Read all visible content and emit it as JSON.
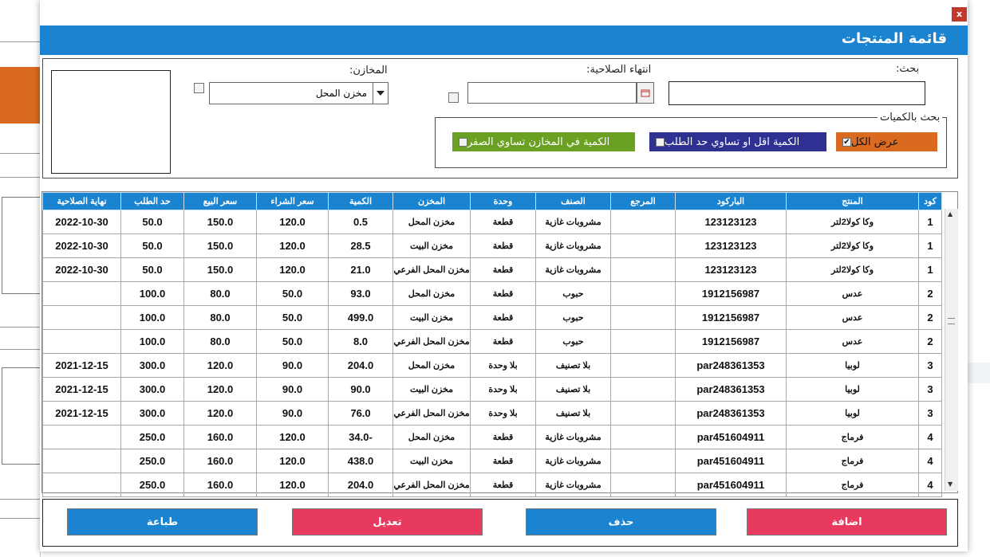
{
  "dialog": {
    "title": "قائمة المنتجات",
    "close_label": "x"
  },
  "search": {
    "label": "بحث:",
    "value": ""
  },
  "expiry": {
    "label": "انتهاء الصلاحية:",
    "value": ""
  },
  "stores": {
    "label": "المخازن:",
    "selected": "مخزن المحل"
  },
  "quantity_filter": {
    "legend": "بحث بالكميات",
    "show_all": {
      "label": "عرض الكل",
      "checked": "✔",
      "color": "#d96a1f"
    },
    "below_limit": {
      "label": "الكمية  اقل او تساوي حد  الطلب",
      "color": "#2f3192"
    },
    "zero_qty": {
      "label": "الكمية في المخازن تساوي الصفر",
      "color": "#6aa122"
    }
  },
  "grid": {
    "header_color": "#1a84d0",
    "columns": [
      "كود",
      "المنتج",
      "الباركود",
      "المرجع",
      "الصنف",
      "وحدة",
      "المخزن",
      "الكمية",
      "سعر الشراء",
      "سعر البيع",
      "حد الطلب",
      "نهاية الصلاحية"
    ],
    "rows": [
      [
        "1",
        "وكا كولا2لتر",
        "123123123",
        "",
        "مشروبات غازية",
        "قطعة",
        "مخزن المحل",
        "0.5",
        "120.0",
        "150.0",
        "50.0",
        "2022-10-30"
      ],
      [
        "1",
        "وكا كولا2لتر",
        "123123123",
        "",
        "مشروبات غازية",
        "قطعة",
        "مخزن البيت",
        "28.5",
        "120.0",
        "150.0",
        "50.0",
        "2022-10-30"
      ],
      [
        "1",
        "وكا كولا2لتر",
        "123123123",
        "",
        "مشروبات غازية",
        "قطعة",
        "مخزن المحل الفرعي",
        "21.0",
        "120.0",
        "150.0",
        "50.0",
        "2022-10-30"
      ],
      [
        "2",
        "عدس",
        "1912156987",
        "",
        "حبوب",
        "قطعة",
        "مخزن المحل",
        "93.0",
        "50.0",
        "80.0",
        "100.0",
        ""
      ],
      [
        "2",
        "عدس",
        "1912156987",
        "",
        "حبوب",
        "قطعة",
        "مخزن البيت",
        "499.0",
        "50.0",
        "80.0",
        "100.0",
        ""
      ],
      [
        "2",
        "عدس",
        "1912156987",
        "",
        "حبوب",
        "قطعة",
        "مخزن المحل الفرعي",
        "8.0",
        "50.0",
        "80.0",
        "100.0",
        ""
      ],
      [
        "3",
        "لوبيا",
        "par248361353",
        "",
        "بلا تصنيف",
        "بلا وحدة",
        "مخزن المحل",
        "204.0",
        "90.0",
        "120.0",
        "300.0",
        "2021-12-15"
      ],
      [
        "3",
        "لوبيا",
        "par248361353",
        "",
        "بلا تصنيف",
        "بلا وحدة",
        "مخزن البيت",
        "90.0",
        "90.0",
        "120.0",
        "300.0",
        "2021-12-15"
      ],
      [
        "3",
        "لوبيا",
        "par248361353",
        "",
        "بلا تصنيف",
        "بلا وحدة",
        "مخزن المحل الفرعي",
        "76.0",
        "90.0",
        "120.0",
        "300.0",
        "2021-12-15"
      ],
      [
        "4",
        "فرماج",
        "par451604911",
        "",
        "مشروبات غازية",
        "قطعة",
        "مخزن المحل",
        "-34.0",
        "120.0",
        "160.0",
        "250.0",
        ""
      ],
      [
        "4",
        "فرماج",
        "par451604911",
        "",
        "مشروبات غازية",
        "قطعة",
        "مخزن البيت",
        "438.0",
        "120.0",
        "160.0",
        "250.0",
        ""
      ],
      [
        "4",
        "فرماج",
        "par451604911",
        "",
        "مشروبات غازية",
        "قطعة",
        "مخزن المحل الفرعي",
        "204.0",
        "120.0",
        "160.0",
        "250.0",
        ""
      ]
    ]
  },
  "actions": {
    "add": {
      "label": "اضافة",
      "color": "#e8395f"
    },
    "delete": {
      "label": "حذف",
      "color": "#1a84d0"
    },
    "edit": {
      "label": "تعديل",
      "color": "#e8395f"
    },
    "print": {
      "label": "طباعة",
      "color": "#1a84d0"
    }
  }
}
